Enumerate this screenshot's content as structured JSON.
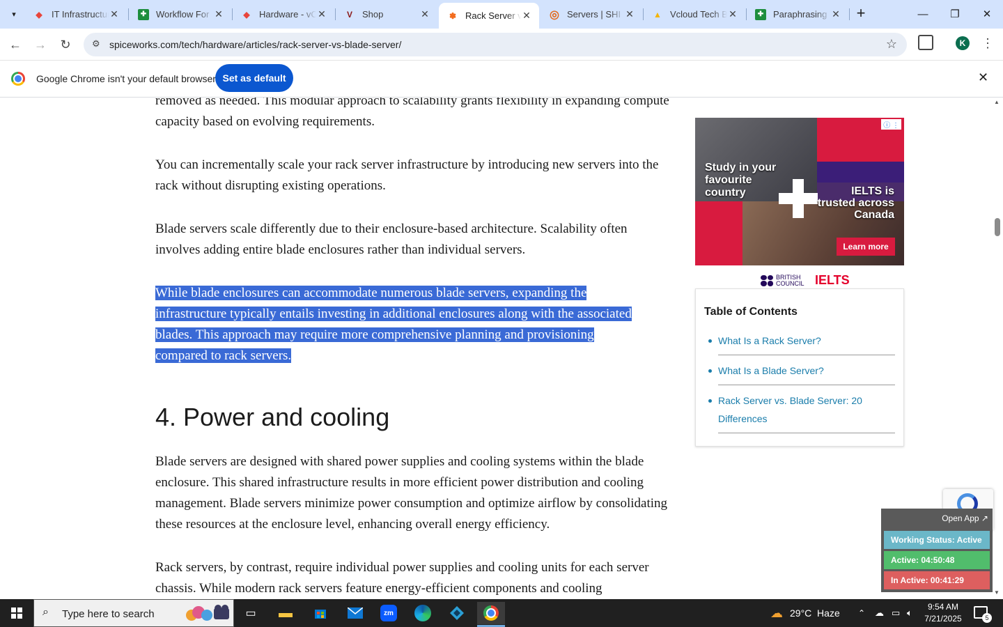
{
  "tabs": [
    {
      "title": "IT Infrastructure",
      "icon": "diamond-red-icon",
      "color": "#e8453c"
    },
    {
      "title": "Workflow For",
      "icon": "sheets-icon",
      "color": "#1e8e3e"
    },
    {
      "title": "Hardware - vC",
      "icon": "diamond-red-icon",
      "color": "#e8453c"
    },
    {
      "title": "Shop",
      "icon": "v-logo-icon",
      "color": "#8b1a1a"
    },
    {
      "title": "Rack Server vs",
      "icon": "spiceworks-icon",
      "color": "#f26b1d",
      "active": true
    },
    {
      "title": "Servers | SHI",
      "icon": "ring-icon",
      "color": "#e36b1f"
    },
    {
      "title": "Vcloud Tech B",
      "icon": "drive-icon",
      "color": "#4285f4"
    },
    {
      "title": "Paraphrasing T",
      "icon": "sheets-icon",
      "color": "#1e8e3e"
    }
  ],
  "toolbar": {
    "url": "spiceworks.com/tech/hardware/articles/rack-server-vs-blade-server/",
    "profile_initial": "K"
  },
  "infobar": {
    "message": "Google Chrome isn't your default browser",
    "button": "Set as default"
  },
  "article": {
    "p0": "removed as needed. This modular approach to scalability grants flexibility in expanding compute capacity based on evolving requirements.",
    "p1": "You can incrementally scale your rack server infrastructure by introducing new servers into the rack without disrupting existing operations.",
    "p2": "Blade servers scale differently due to their enclosure-based architecture. Scalability often involves adding entire blade enclosures rather than individual servers.",
    "p3_lines": [
      "While blade enclosures can accommodate numerous blade servers, expanding the",
      "infrastructure typically entails investing in additional enclosures along with the associated",
      "blades. This approach may require more comprehensive planning and provisioning",
      "compared to rack servers."
    ],
    "heading": "4. Power and cooling",
    "p4": "Blade servers are designed with shared power supplies and cooling systems within the blade enclosure. This shared infrastructure results in more efficient power distribution and cooling management. Blade servers minimize power consumption and optimize airflow by consolidating these resources at the enclosure level, enhancing overall energy efficiency.",
    "p5": "Rack servers, by contrast, require individual power supplies and cooling units for each server chassis. While modern rack servers feature energy-efficient components and cooling"
  },
  "ad": {
    "left_text": "Study in your favourite country",
    "right_text": "IELTS is trusted across Canada",
    "cta": "Learn more",
    "brand1": "BRITISH COUNCIL",
    "brand2": "IELTS"
  },
  "toc": {
    "title": "Table of Contents",
    "items": [
      "What Is a Rack Server?",
      "What Is a Blade Server?",
      "Rack Server vs. Blade Server: 20 Differences"
    ]
  },
  "status_widget": {
    "open_app": "Open App ↗",
    "working": "Working Status: Active",
    "active": "Active: 04:50:48",
    "inactive": "In Active: 00:41:29"
  },
  "taskbar": {
    "search_placeholder": "Type here to search",
    "weather": "29°C  Haze",
    "time": "9:54 AM",
    "date": "7/21/2025",
    "notifications": "5"
  }
}
